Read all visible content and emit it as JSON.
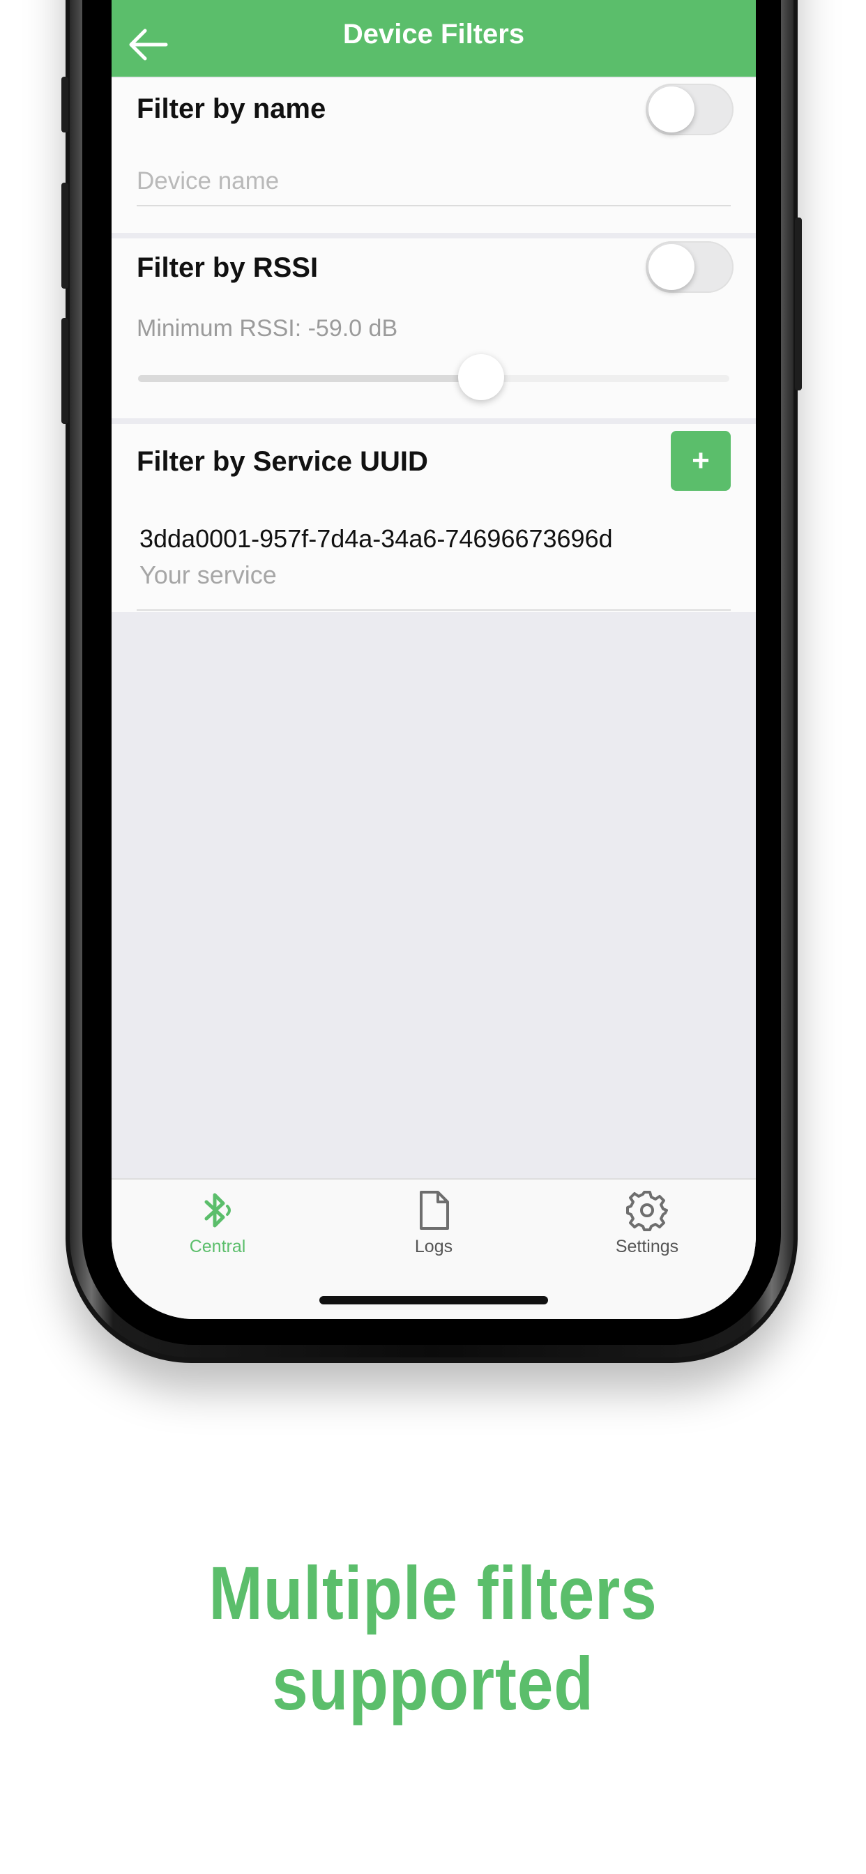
{
  "nav": {
    "title": "Device Filters"
  },
  "filter_name": {
    "title": "Filter by name",
    "toggle_on": false,
    "placeholder": "Device name"
  },
  "filter_rssi": {
    "title": "Filter by RSSI",
    "toggle_on": false,
    "min_label": "Minimum RSSI: -59.0 dB",
    "slider_fraction": 0.58
  },
  "filter_uuid": {
    "title": "Filter by Service UUID",
    "add_label": "+",
    "items": [
      {
        "uuid": "3dda0001-957f-7d4a-34a6-74696673696d",
        "label": "Your service"
      }
    ]
  },
  "tabs": [
    {
      "label": "Central",
      "icon": "bluetooth-icon",
      "active": true
    },
    {
      "label": "Logs",
      "icon": "document-icon",
      "active": false
    },
    {
      "label": "Settings",
      "icon": "gear-icon",
      "active": false
    }
  ],
  "colors": {
    "accent": "#5bbe6b",
    "inactive": "#6e6e6e"
  },
  "caption": {
    "line1": "Multiple filters",
    "line2": "supported"
  }
}
